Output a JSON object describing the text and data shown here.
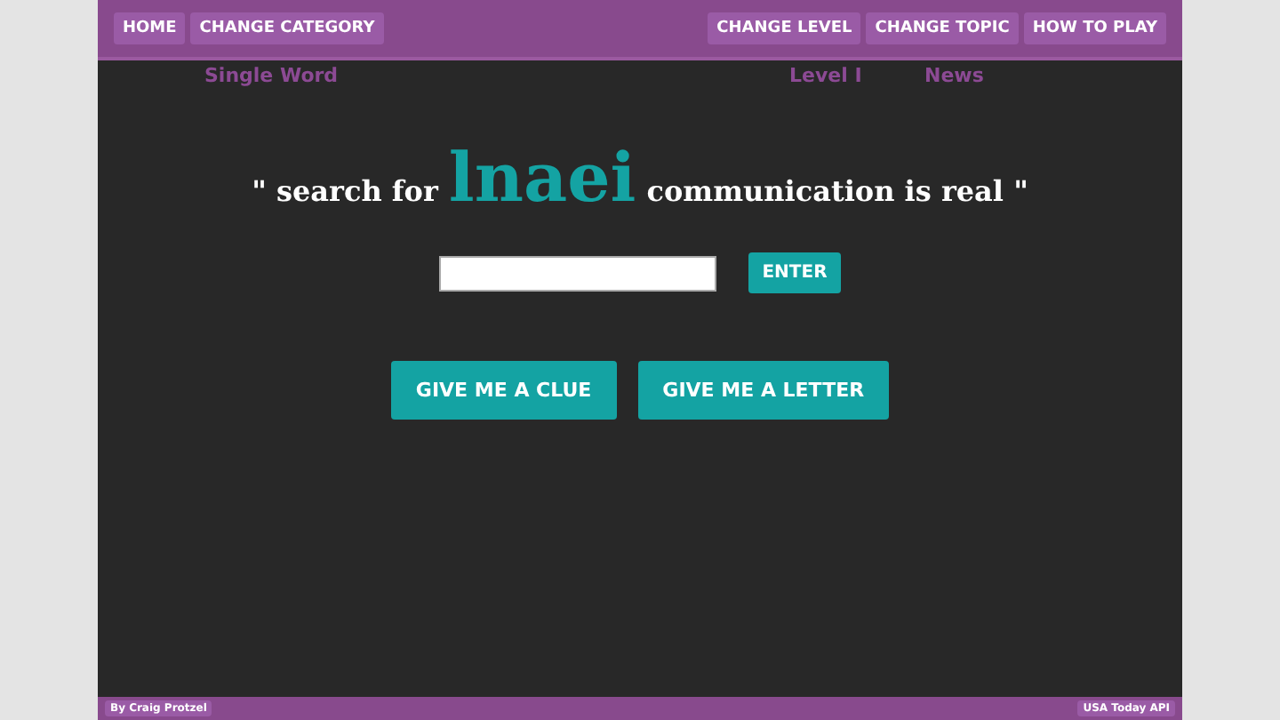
{
  "nav": {
    "left": [
      "HOME",
      "CHANGE CATEGORY"
    ],
    "right": [
      "CHANGE LEVEL",
      "CHANGE TOPIC",
      "HOW TO PLAY"
    ]
  },
  "settings": {
    "category": "Single Word",
    "level": "Level I",
    "topic": "News"
  },
  "puzzle": {
    "before": "\" search for",
    "word": "lnaei",
    "after": "communication is real \""
  },
  "answer": {
    "button": "ENTER"
  },
  "actions": [
    "GIVE ME A CLUE",
    "GIVE ME A LETTER"
  ],
  "footer": {
    "credit": "By Craig Protzel",
    "source": "USA Today API"
  }
}
